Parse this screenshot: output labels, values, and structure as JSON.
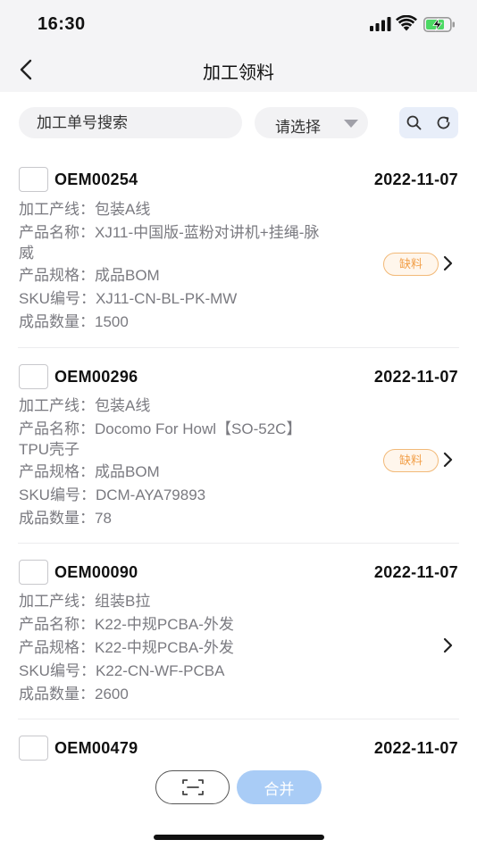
{
  "status_bar": {
    "time": "16:30"
  },
  "header": {
    "title": "加工领料"
  },
  "search": {
    "placeholder": "加工单号搜索",
    "select_value": "请选择"
  },
  "field_labels": {
    "line": "加工产线：",
    "name": "产品名称：",
    "spec": "产品规格：",
    "sku": "SKU编号：",
    "qty": "成品数量："
  },
  "orders": [
    {
      "order_no": "OEM00254",
      "date": "2022-11-07",
      "line": "包装A线",
      "name_line1": "XJ11-中国版-蓝粉对讲机+挂绳-脉",
      "name_line2": "威",
      "spec": "成品BOM",
      "sku": "XJ11-CN-BL-PK-MW",
      "qty": "1500",
      "badge": "缺料"
    },
    {
      "order_no": "OEM00296",
      "date": "2022-11-07",
      "line": "包装A线",
      "name_line1": "Docomo For Howl【SO-52C】",
      "name_line2": "TPU壳子",
      "spec": "成品BOM",
      "sku": "DCM-AYA79893",
      "qty": "78",
      "badge": "缺料"
    },
    {
      "order_no": "OEM00090",
      "date": "2022-11-07",
      "line": "组装B拉",
      "name_line1": "K22-中规PCBA-外发",
      "spec": "K22-中规PCBA-外发",
      "sku": "K22-CN-WF-PCBA",
      "qty": "2600"
    },
    {
      "order_no": "OEM00479",
      "date": "2022-11-07"
    }
  ],
  "bottom": {
    "merge_label": "合并"
  },
  "colors": {
    "accent": "#a9ccf6",
    "badge_text": "#f2a04a",
    "badge_border": "#f2b978"
  }
}
